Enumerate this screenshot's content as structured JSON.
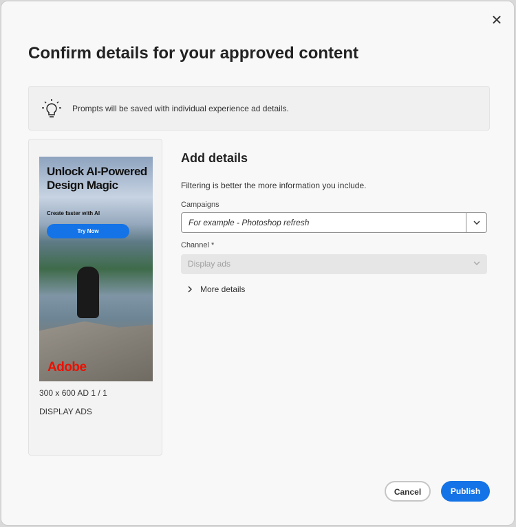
{
  "dialog": {
    "title": "Confirm details for your approved content",
    "close_icon": "close-icon"
  },
  "banner": {
    "icon": "lightbulb-icon",
    "text": "Prompts will be saved with individual experience ad details."
  },
  "preview": {
    "ad": {
      "headline": "Unlock AI-Powered Design Magic",
      "subhead": "Create faster with AI",
      "cta": "Try Now",
      "logo": "Adobe"
    },
    "dimensions": "300 x 600 AD 1 / 1",
    "channel": "DISPLAY ADS"
  },
  "form": {
    "heading": "Add details",
    "description": "Filtering is better the more information you include.",
    "campaigns_label": "Campaigns",
    "campaigns_placeholder": "For example - Photoshop refresh",
    "channel_label": "Channel",
    "required_mark": "*",
    "channel_value": "Display ads",
    "more_details": "More details"
  },
  "footer": {
    "cancel": "Cancel",
    "publish": "Publish"
  },
  "colors": {
    "accent": "#1473e6",
    "brand": "#eb1000"
  }
}
